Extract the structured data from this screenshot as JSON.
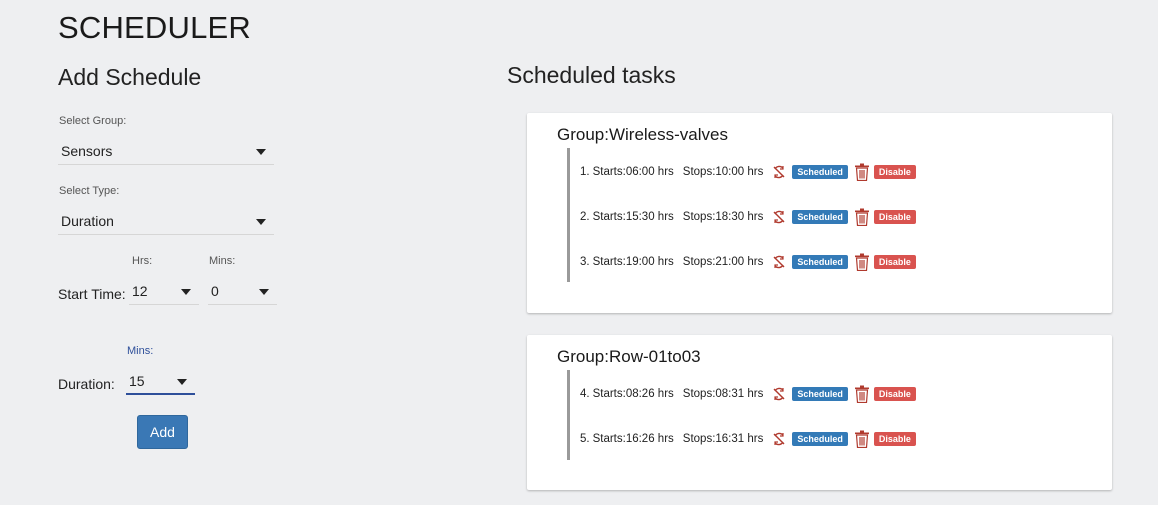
{
  "page": {
    "title": "SCHEDULER"
  },
  "add_schedule": {
    "heading": "Add Schedule",
    "group_label": "Select Group:",
    "group_value": "Sensors",
    "type_label": "Select Type:",
    "type_value": "Duration",
    "start_time_label": "Start Time:",
    "hrs_label": "Hrs:",
    "hrs_value": "12",
    "mins_label": "Mins:",
    "mins_value": "0",
    "duration_label": "Duration:",
    "duration_mins_label": "Mins:",
    "duration_value": "15",
    "add_button": "Add"
  },
  "scheduled_tasks": {
    "heading": "Scheduled tasks",
    "groups": [
      {
        "title": "Group:Wireless-valves",
        "tasks": [
          {
            "num": "1.",
            "starts": "Starts:06:00 hrs",
            "stops": "Stops:10:00 hrs",
            "status": "Scheduled",
            "action": "Disable"
          },
          {
            "num": "2.",
            "starts": "Starts:15:30 hrs",
            "stops": "Stops:18:30 hrs",
            "status": "Scheduled",
            "action": "Disable"
          },
          {
            "num": "3.",
            "starts": "Starts:19:00 hrs",
            "stops": "Stops:21:00 hrs",
            "status": "Scheduled",
            "action": "Disable"
          }
        ]
      },
      {
        "title": "Group:Row-01to03",
        "tasks": [
          {
            "num": "4.",
            "starts": "Starts:08:26 hrs",
            "stops": "Stops:08:31 hrs",
            "status": "Scheduled",
            "action": "Disable"
          },
          {
            "num": "5.",
            "starts": "Starts:16:26 hrs",
            "stops": "Stops:16:31 hrs",
            "status": "Scheduled",
            "action": "Disable"
          }
        ]
      }
    ]
  },
  "icons": {
    "sync": "sync-disabled-icon",
    "delete": "trash-icon"
  },
  "colors": {
    "scheduled_badge": "#337ab7",
    "disable_badge": "#d9534f",
    "add_button": "#3a78b5",
    "icon_red": "#b03a2e"
  }
}
